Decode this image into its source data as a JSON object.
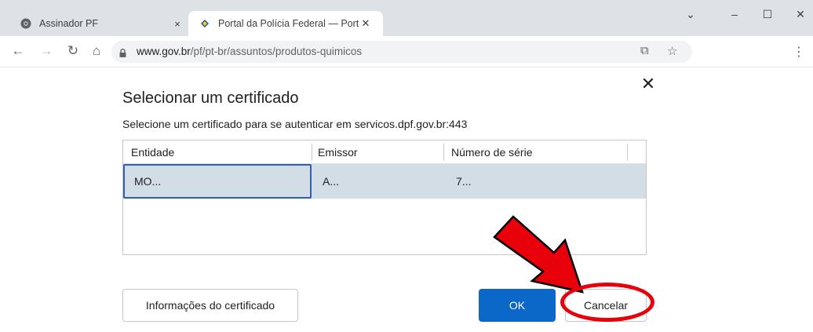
{
  "tabs": [
    {
      "label": "Assinador PF",
      "close": "×"
    },
    {
      "label": "Portal da Polícia Federal — Portu",
      "close": "✕"
    }
  ],
  "window_controls": {
    "chevron": "⌄",
    "minimize": "–",
    "maximize": "☐",
    "close": "✕"
  },
  "toolbar": {
    "back": "←",
    "forward": "→",
    "reload": "↻",
    "home": "⌂",
    "url_host": "www.gov.br",
    "url_path": "/pf/pt-br/assuntos/produtos-quimicos",
    "share_icon": "⧉",
    "star_icon": "☆",
    "menu": "⋮"
  },
  "dialog": {
    "close": "✕",
    "title": "Selecionar um certificado",
    "description": "Selecione um certificado para se autenticar em servicos.dpf.gov.br:443",
    "columns": [
      "Entidade",
      "Emissor",
      "Número de série"
    ],
    "rows": [
      {
        "entidade": "MO...",
        "emissor": "A...",
        "numero_serie": "7..."
      }
    ],
    "info_button": "Informações do certificado",
    "ok_button": "OK",
    "cancel_button": "Cancelar"
  },
  "annotation": {
    "color": "#e8000b"
  },
  "colors": {
    "titlebar": "#dee1e6",
    "ok_button": "#0b68c9",
    "selected_row": "#d3dde6",
    "focus_border": "#2f5fb3"
  },
  "icons": [
    "chrome-icon",
    "gov-br-icon",
    "lock-icon",
    "share-icon",
    "star-icon",
    "menu-icon"
  ]
}
